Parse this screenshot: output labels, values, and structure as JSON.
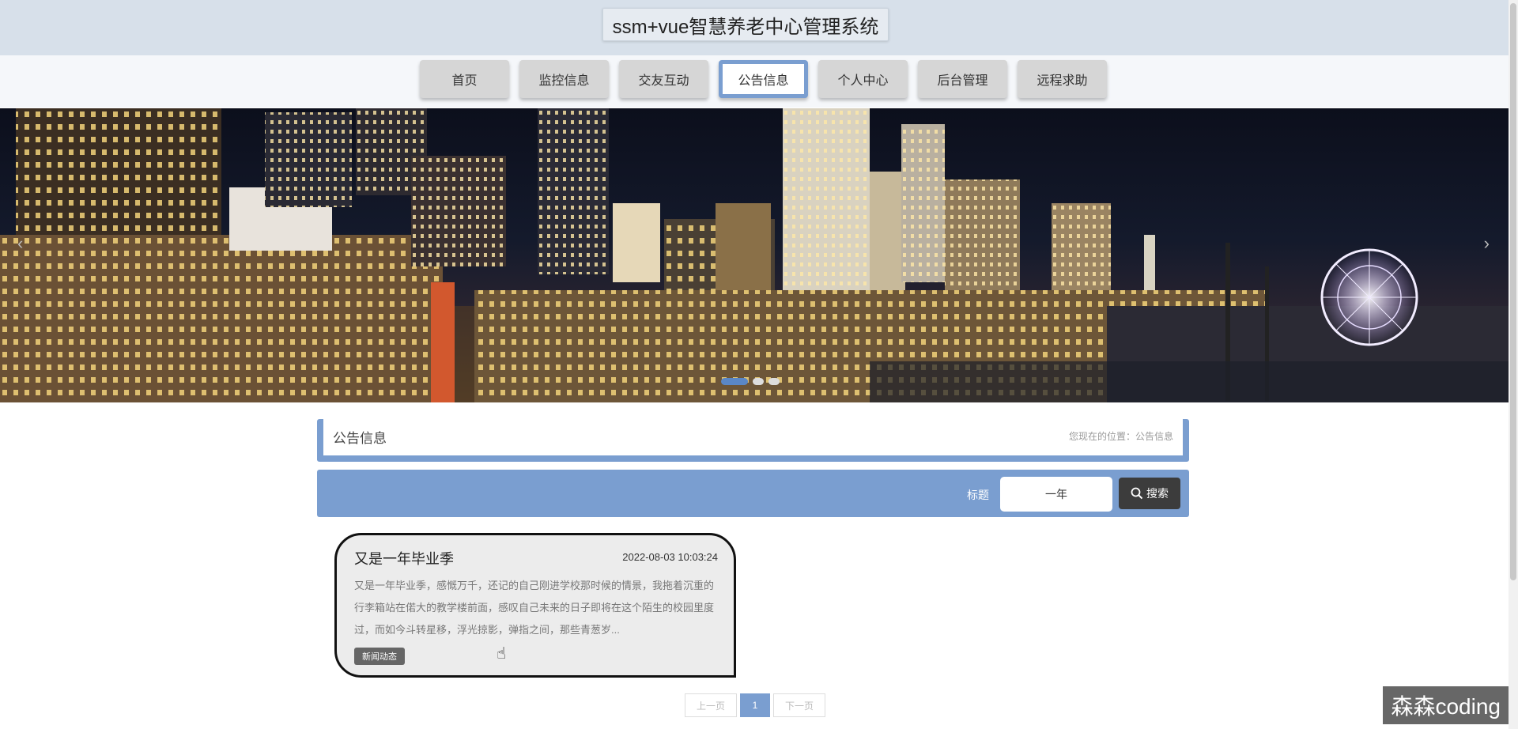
{
  "header": {
    "title": "ssm+vue智慧养老中心管理系统"
  },
  "nav": {
    "items": [
      "首页",
      "监控信息",
      "交友互动",
      "公告信息",
      "个人中心",
      "后台管理",
      "远程求助"
    ],
    "active_index": 3
  },
  "banner": {
    "prev": "‹",
    "next": "›",
    "slide_count": 3,
    "active_slide": 0
  },
  "breadcrumb": {
    "title": "公告信息",
    "path": "您现在的位置：公告信息"
  },
  "search": {
    "label": "标题",
    "value": "一年",
    "button_label": "搜索"
  },
  "card": {
    "title": "又是一年毕业季",
    "date": "2022-08-03 10:03:24",
    "body": "又是一年毕业季，感慨万千，还记的自己刚进学校那时候的情景，我拖着沉重的行李箱站在偌大的教学楼前面，感叹自己未来的日子即将在这个陌生的校园里度过，而如今斗转星移，浮光掠影，弹指之间，那些青葱岁...",
    "tag": "新闻动态"
  },
  "pagination": {
    "prev": "上一页",
    "page": "1",
    "next": "下一页"
  },
  "watermark": "森森coding",
  "colors": {
    "accent": "#7a9ed0",
    "dark_button": "#3c3c3c",
    "header_bg": "#d7e0ea"
  }
}
